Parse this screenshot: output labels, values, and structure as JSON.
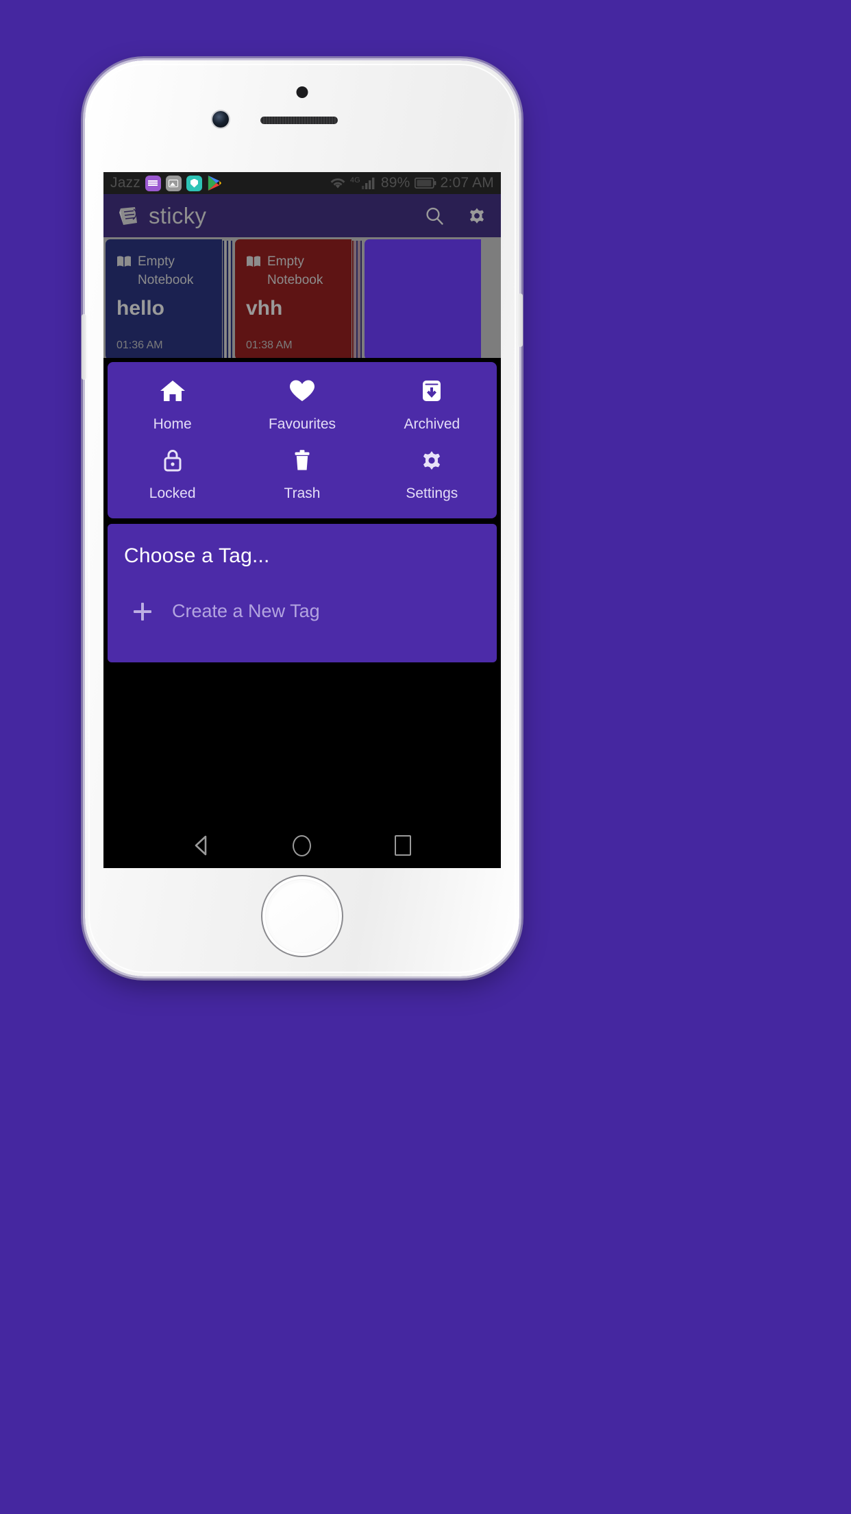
{
  "status_bar": {
    "carrier": "Jazz",
    "notification_icons": [
      "keyboard-icon",
      "gallery-icon",
      "shield-icon",
      "play-store-icon"
    ],
    "network_type": "4G",
    "battery_percent": "89%",
    "clock": "2:07 AM"
  },
  "app_bar": {
    "title": "sticky",
    "logo_icon": "sticky-note-logo-icon",
    "actions": [
      {
        "name": "search-icon",
        "label": "Search"
      },
      {
        "name": "settings-gear-icon",
        "label": "Settings"
      }
    ]
  },
  "notes": [
    {
      "notebook": "Empty Notebook",
      "title": "hello",
      "time": "01:36 AM",
      "color": "#1B2150",
      "icon": "book-icon"
    },
    {
      "notebook": "Empty Notebook",
      "title": "vhh",
      "time": "01:38 AM",
      "color": "#5E1414",
      "icon": "book-icon"
    }
  ],
  "menu": {
    "items": [
      {
        "label": "Home",
        "icon": "home-icon"
      },
      {
        "label": "Favourites",
        "icon": "heart-icon"
      },
      {
        "label": "Archived",
        "icon": "archive-icon"
      },
      {
        "label": "Locked",
        "icon": "lock-icon"
      },
      {
        "label": "Trash",
        "icon": "trash-icon"
      },
      {
        "label": "Settings",
        "icon": "gear-icon"
      }
    ]
  },
  "tag_panel": {
    "title": "Choose a Tag...",
    "create_label": "Create a New Tag",
    "create_icon": "plus-icon"
  },
  "nav_bar": {
    "back": "back-triangle-icon",
    "home": "home-circle-icon",
    "recents": "recents-square-icon"
  },
  "colors": {
    "page_background": "#4527A0",
    "app_bar": "#2A1F52",
    "panel": "#4C2BA8",
    "note_a": "#1B2150",
    "note_b": "#5E1414",
    "notes_gutter": "#7D7D7D"
  }
}
